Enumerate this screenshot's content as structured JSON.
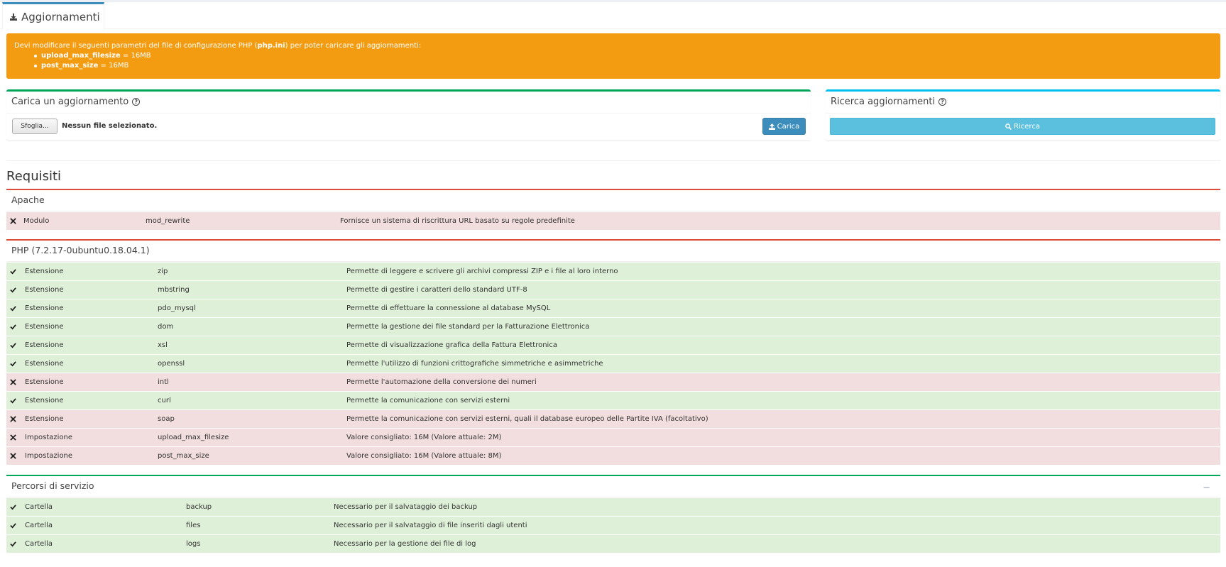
{
  "tab": {
    "label": "Aggiornamenti"
  },
  "alert": {
    "text_before": "Devi modificare il seguenti parametri del file di configurazione PHP (",
    "file": "php.ini",
    "text_after": ") per poter caricare gli aggiornamenti:",
    "items": [
      {
        "name": "upload_max_filesize",
        "value": " = 16MB"
      },
      {
        "name": "post_max_size",
        "value": " = 16MB"
      }
    ]
  },
  "upload": {
    "title": "Carica un aggiornamento",
    "browse_label": "Sfoglia...",
    "no_file": "Nessun file selezionato.",
    "submit_label": "Carica"
  },
  "search": {
    "title": "Ricerca aggiornamenti",
    "button_label": "Ricerca"
  },
  "requirements": {
    "title": "Requisiti",
    "apache": {
      "title": "Apache",
      "rows": [
        {
          "status": "ko",
          "type": "Modulo",
          "name": "mod_rewrite",
          "description": "Fornisce un sistema di riscrittura URL basato su regole predefinite"
        }
      ]
    },
    "php": {
      "title": "PHP (7.2.17-0ubuntu0.18.04.1)",
      "rows": [
        {
          "status": "ok",
          "type": "Estensione",
          "name": "zip",
          "description": "Permette di leggere e scrivere gli archivi compressi ZIP e i file al loro interno"
        },
        {
          "status": "ok",
          "type": "Estensione",
          "name": "mbstring",
          "description": "Permette di gestire i caratteri dello standard UTF-8"
        },
        {
          "status": "ok",
          "type": "Estensione",
          "name": "pdo_mysql",
          "description": "Permette di effettuare la connessione al database MySQL"
        },
        {
          "status": "ok",
          "type": "Estensione",
          "name": "dom",
          "description": "Permette la gestione dei file standard per la Fatturazione Elettronica"
        },
        {
          "status": "ok",
          "type": "Estensione",
          "name": "xsl",
          "description": "Permette di visualizzazione grafica della Fattura Elettronica"
        },
        {
          "status": "ok",
          "type": "Estensione",
          "name": "openssl",
          "description": "Permette l'utilizzo di funzioni crittografiche simmetriche e asimmetriche"
        },
        {
          "status": "ko",
          "type": "Estensione",
          "name": "intl",
          "description": "Permette l'automazione della conversione dei numeri"
        },
        {
          "status": "ok",
          "type": "Estensione",
          "name": "curl",
          "description": "Permette la comunicazione con servizi esterni"
        },
        {
          "status": "ko",
          "type": "Estensione",
          "name": "soap",
          "description": "Permette la comunicazione con servizi esterni, quali il database europeo delle Partite IVA (facoltativo)"
        },
        {
          "status": "ko",
          "type": "Impostazione",
          "name": "upload_max_filesize",
          "description": "Valore consigliato: 16M (Valore attuale: 2M)"
        },
        {
          "status": "ko",
          "type": "Impostazione",
          "name": "post_max_size",
          "description": "Valore consigliato: 16M (Valore attuale: 8M)"
        }
      ]
    },
    "paths": {
      "title": "Percorsi di servizio",
      "collapse_label": "−",
      "rows": [
        {
          "status": "ok",
          "type": "Cartella",
          "name": "backup",
          "description": "Necessario per il salvataggio dei backup"
        },
        {
          "status": "ok",
          "type": "Cartella",
          "name": "files",
          "description": "Necessario per il salvataggio di file inseriti dagli utenti"
        },
        {
          "status": "ok",
          "type": "Cartella",
          "name": "logs",
          "description": "Necessario per la gestione dei file di log"
        }
      ]
    }
  },
  "colors": {
    "ok": "#dff0d8",
    "ko": "#f2dede",
    "warning": "#f39c12",
    "primary": "#3c8dbc",
    "info": "#5bc0de",
    "danger_border": "#dd4b39",
    "success_border": "#00a65a"
  }
}
